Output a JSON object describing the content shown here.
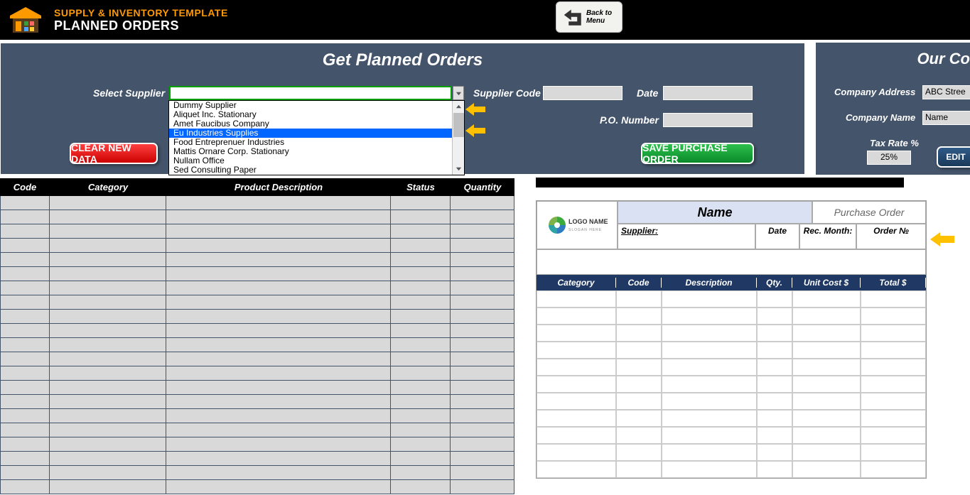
{
  "header": {
    "title": "SUPPLY & INVENTORY TEMPLATE",
    "subtitle": "PLANNED ORDERS",
    "back_line1": "Back to",
    "back_line2": "Menu"
  },
  "panel": {
    "title": "Get Planned Orders",
    "select_supplier": "Select Supplier",
    "supplier_code": "Supplier Code",
    "date": "Date",
    "po_number": "P.O. Number",
    "clear_btn": "CLEAR NEW DATA",
    "save_btn": "SAVE PURCHASE ORDER"
  },
  "panel_right": {
    "title": "Our Co",
    "addr_label": "Company Address",
    "addr_value": "ABC Stree",
    "name_label": "Company Name",
    "name_value": "Name",
    "tax_label": "Tax Rate %",
    "tax_value": "25%",
    "edit_btn": "EDIT"
  },
  "suppliers": [
    "Dummy Supplier",
    "Aliquet Inc. Stationary",
    "Amet Faucibus Company",
    "Eu Industries Supplies",
    "Food Entreprenuer Industries",
    "Mattis Ornare Corp. Stationary",
    "Nullam Office",
    "Sed Consulting Paper"
  ],
  "supplier_selected_index": 3,
  "left_table": {
    "headers": {
      "code": "Code",
      "category": "Category",
      "desc": "Product Description",
      "status": "Status",
      "qty": "Quantity"
    },
    "rows": 21
  },
  "preview": {
    "logo_text": "LOGO NAME",
    "logo_sub": "SLOGAN HERE",
    "name": "Name",
    "po_label": "Purchase Order",
    "supplier_label": "Supplier:",
    "date_label": "Date",
    "rec_label": "Rec. Month:",
    "order_label": "Order №",
    "headers": {
      "cat": "Category",
      "code": "Code",
      "desc": "Description",
      "qty": "Qty.",
      "uc": "Unit Cost $",
      "tot": "Total $"
    },
    "rows": 11
  }
}
